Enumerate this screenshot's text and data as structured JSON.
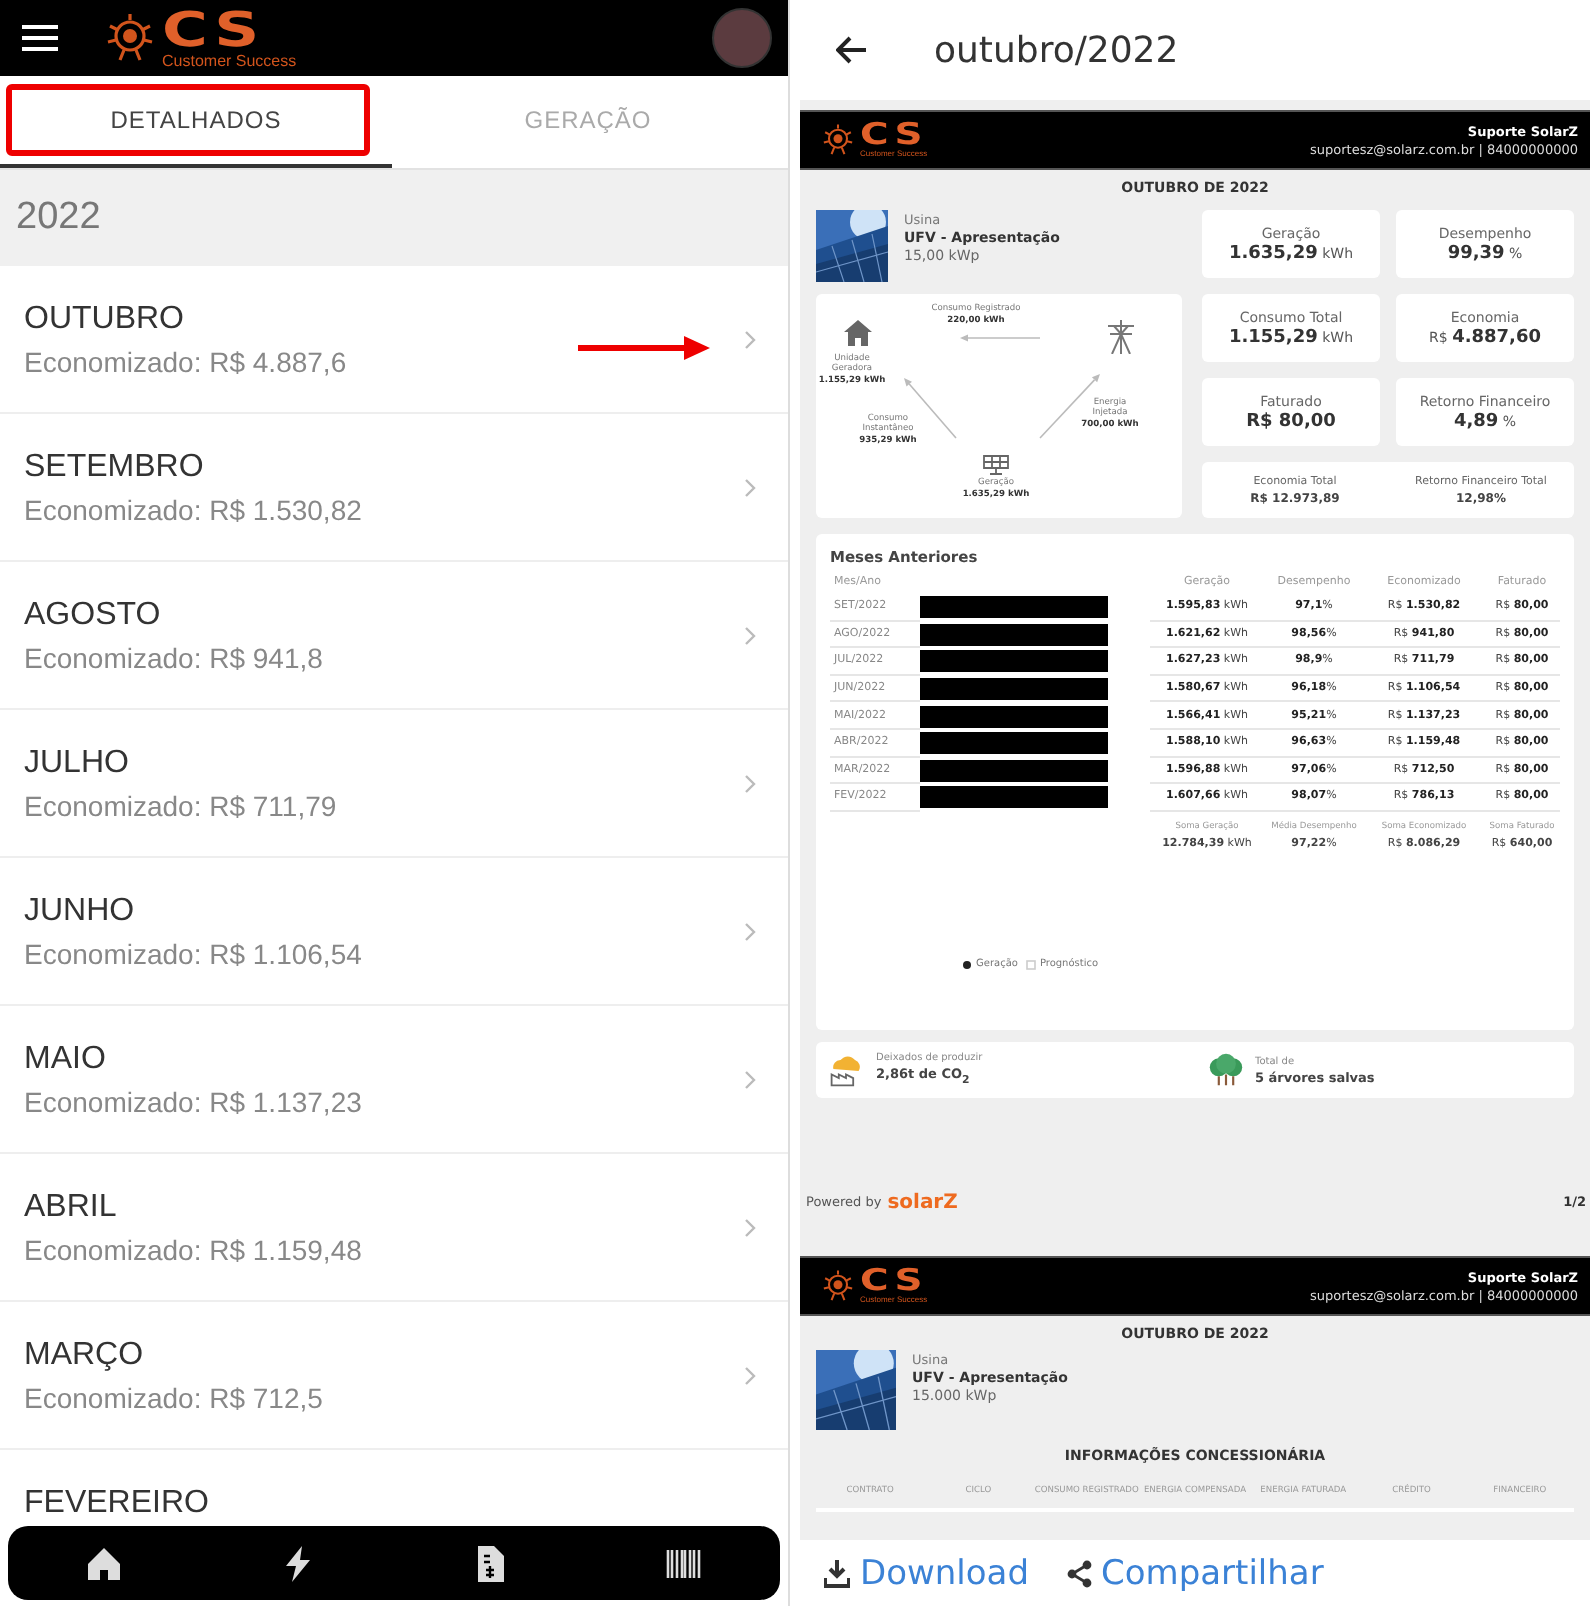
{
  "app": {
    "header": {
      "logo_mark": "CS",
      "logo_tagline": "Customer Success"
    },
    "tabs": [
      {
        "label": "DETALHADOS",
        "selected": true
      },
      {
        "label": "GERAÇÃO",
        "selected": false
      }
    ],
    "year": "2022",
    "months": [
      {
        "name": "OUTUBRO",
        "saved": "Economizado: R$ 4.887,6"
      },
      {
        "name": "SETEMBRO",
        "saved": "Economizado: R$ 1.530,82"
      },
      {
        "name": "AGOSTO",
        "saved": "Economizado: R$ 941,8"
      },
      {
        "name": "JULHO",
        "saved": "Economizado: R$ 711,79"
      },
      {
        "name": "JUNHO",
        "saved": "Economizado: R$ 1.106,54"
      },
      {
        "name": "MAIO",
        "saved": "Economizado: R$ 1.137,23"
      },
      {
        "name": "ABRIL",
        "saved": "Economizado: R$ 1.159,48"
      },
      {
        "name": "MARÇO",
        "saved": "Economizado: R$ 712,5"
      },
      {
        "name": "FEVEREIRO"
      }
    ],
    "nav": [
      {
        "kind": "home"
      },
      {
        "kind": "bolt"
      },
      {
        "kind": "invoice"
      },
      {
        "kind": "barcode"
      }
    ]
  },
  "report": {
    "title": "outubro/2022",
    "page_1": {
      "header": {
        "logo_mark": "CS",
        "logo_tagline": "Customer Success",
        "support_name": "Suporte SolarZ",
        "support_contact": "suportesz@solarz.com.br | 84000000000"
      },
      "period": "OUTUBRO DE 2022",
      "plant": {
        "label": "Usina",
        "name": "UFV - Apresentação",
        "power": "15,00 kWp"
      },
      "flow": [
        {
          "kind": "registered",
          "label": "Consumo Registrado",
          "value": "220,00 kWh"
        },
        {
          "kind": "unit",
          "label": "Unidade Geradora",
          "value": "1.155,29 kWh"
        },
        {
          "kind": "instant",
          "label": "Consumo Instantâneo",
          "value": "935,29 kWh"
        },
        {
          "kind": "injected",
          "label": "Energia Injetada",
          "value": "700,00 kWh"
        },
        {
          "kind": "generation",
          "label": "Geração",
          "value": "1.635,29 kWh"
        }
      ],
      "stats": [
        {
          "label": "Geração",
          "value": "1.635,29",
          "unit": "kWh"
        },
        {
          "label": "Desempenho",
          "value": "99,39",
          "unit": "%"
        },
        {
          "label": "Consumo Total",
          "value": "1.155,29",
          "unit": "kWh"
        },
        {
          "label": "Economia",
          "prefix": "R$",
          "value": "4.887,60"
        },
        {
          "label": "Faturado",
          "value": "R$ 80,00"
        },
        {
          "label": "Retorno Financeiro",
          "value": "4,89",
          "unit": "%"
        }
      ],
      "totals": [
        {
          "label": "Economia Total",
          "value": "R$ 12.973,89"
        },
        {
          "label": "Retorno Financeiro Total",
          "value": "12,98%"
        }
      ],
      "history": {
        "title": "Meses Anteriores",
        "columns": [
          "Mes/Ano",
          "Geração",
          "Desempenho",
          "Economizado",
          "Faturado"
        ],
        "rows": [
          {
            "month": "SET/2022",
            "generation": "**1.595,83** kWh",
            "performance": "**97,1**%",
            "saved": "R$ **1.530,82**",
            "billed": "R$ **80,00**"
          },
          {
            "month": "AGO/2022",
            "generation": "**1.621,62** kWh",
            "performance": "**98,56**%",
            "saved": "R$ **941,80**",
            "billed": "R$ **80,00**"
          },
          {
            "month": "JUL/2022",
            "generation": "**1.627,23** kWh",
            "performance": "**98,9**%",
            "saved": "R$ **711,79**",
            "billed": "R$ **80,00**"
          },
          {
            "month": "JUN/2022",
            "generation": "**1.580,67** kWh",
            "performance": "**96,18**%",
            "saved": "R$ **1.106,54**",
            "billed": "R$ **80,00**"
          },
          {
            "month": "MAI/2022",
            "generation": "**1.566,41** kWh",
            "performance": "**95,21**%",
            "saved": "R$ **1.137,23**",
            "billed": "R$ **80,00**"
          },
          {
            "month": "ABR/2022",
            "generation": "**1.588,10** kWh",
            "performance": "**96,63**%",
            "saved": "R$ **1.159,48**",
            "billed": "R$ **80,00**"
          },
          {
            "month": "MAR/2022",
            "generation": "**1.596,88** kWh",
            "performance": "**97,06**%",
            "saved": "R$ **712,50**",
            "billed": "R$ **80,00**"
          },
          {
            "month": "FEV/2022",
            "generation": "**1.607,66** kWh",
            "performance": "**98,07**%",
            "saved": "R$ **786,13**",
            "billed": "R$ **80,00**"
          }
        ],
        "summary": [
          {
            "label": "Soma Geração",
            "value": "**12.784,39** kWh"
          },
          {
            "label": "Média Desempenho",
            "value": "**97,22**%"
          },
          {
            "label": "Soma Economizado",
            "value": "R$ **8.086,29**"
          },
          {
            "label": "Soma Faturado",
            "value": "R$ **640,00**"
          }
        ],
        "legend": [
          {
            "kind": "filled",
            "label": "Geração"
          },
          {
            "kind": "hollow",
            "label": "Prognóstico"
          }
        ]
      },
      "environment": [
        {
          "kind": "co2",
          "label": "Deixados de produzir",
          "value": "2,86t de CO$_{2}$"
        },
        {
          "kind": "trees",
          "label": "Total de",
          "value": "5 árvores salvas"
        }
      ],
      "footer": {
        "powered_by": "Powered by",
        "brand": "solarZ",
        "page": "1/2"
      }
    },
    "page_2": {
      "header": {
        "logo_mark": "CS",
        "logo_tagline": "Customer Success",
        "support_name": "Suporte SolarZ",
        "support_contact": "suportesz@solarz.com.br | 84000000000"
      },
      "period": "OUTUBRO DE 2022",
      "plant": {
        "label": "Usina",
        "name": "UFV - Apresentação",
        "power": "15.000 kWp"
      },
      "section": "INFORMAÇÕES CONCESSIONÁRIA",
      "columns": [
        "CONTRATO",
        "CICLO",
        "CONSUMO REGISTRADO",
        "ENERGIA COMPENSADA",
        "ENERGIA FATURADA",
        "CRÉDITO",
        "FINANCEIRO"
      ]
    },
    "actions": [
      {
        "kind": "download",
        "label": "Download"
      },
      {
        "kind": "share",
        "label": "Compartilhar"
      }
    ]
  }
}
